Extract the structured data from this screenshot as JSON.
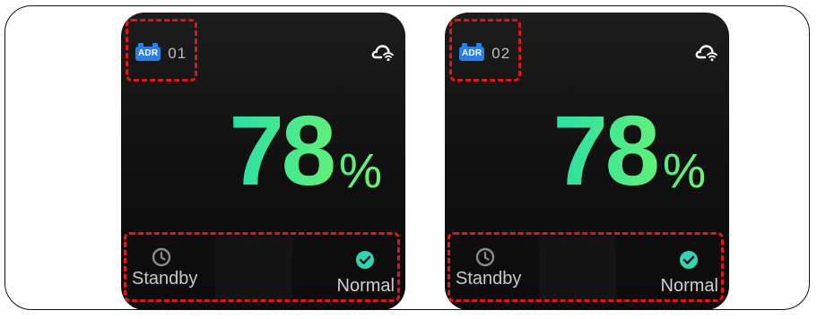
{
  "cards": [
    {
      "badge": "ADR",
      "device_number": "01",
      "value": "78",
      "unit": "%",
      "left_status": "Standby",
      "right_status": "Normal",
      "icons": {
        "badge": "adr-device-icon",
        "cloud": "cloud-wifi-icon",
        "standby": "clock-icon",
        "normal": "check-circle-icon"
      }
    },
    {
      "badge": "ADR",
      "device_number": "02",
      "value": "78",
      "unit": "%",
      "left_status": "Standby",
      "right_status": "Normal",
      "icons": {
        "badge": "adr-device-icon",
        "cloud": "cloud-wifi-icon",
        "standby": "clock-icon",
        "normal": "check-circle-icon"
      }
    }
  ],
  "colors": {
    "card_bg": "#141414",
    "accent_gradient_start": "#29dea6",
    "accent_gradient_end": "#60f07a",
    "badge_blue": "#2a7ee8",
    "highlight_red": "#e0161b",
    "check_teal": "#2fd6b0"
  }
}
